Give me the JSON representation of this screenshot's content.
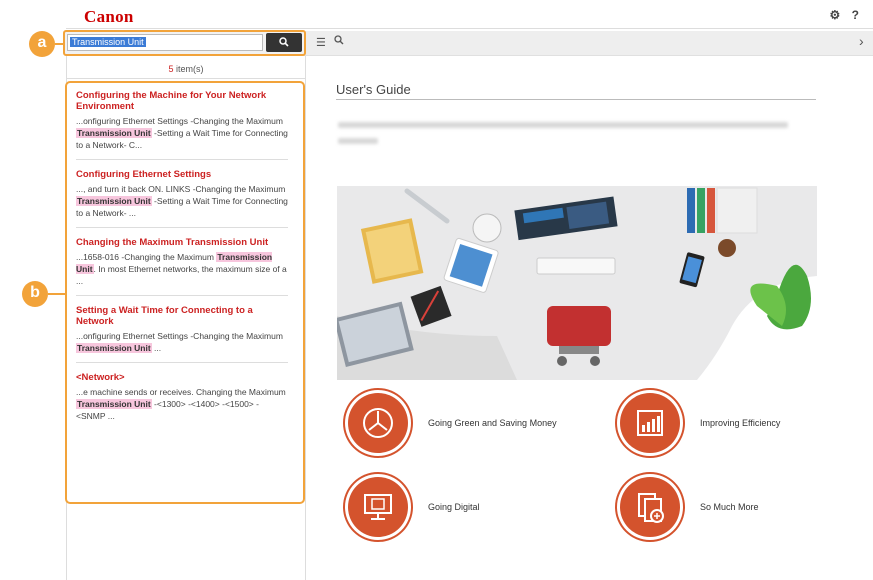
{
  "header": {
    "logo": "Canon",
    "settings_icon": "gear-icon",
    "help_icon": "help-icon",
    "help_glyph": "?"
  },
  "search": {
    "value": "Transmission Unit",
    "button_icon": "search-icon"
  },
  "toolbar": {
    "list_icon": "list-icon",
    "search_icon": "search-icon",
    "next_icon": "chevron-right-icon"
  },
  "sidebar": {
    "count": {
      "number": "5",
      "suffix": " item(s)"
    },
    "results": [
      {
        "title": "Configuring the Machine for Your Network Environment",
        "snippet_before": "...onfiguring Ethernet Settings -Changing the Maximum ",
        "highlight": "Transmission Unit",
        "snippet_after": " -Setting a Wait Time for Connecting to a Network- C..."
      },
      {
        "title": "Configuring Ethernet Settings",
        "snippet_before": "..., and turn it back ON. LINKS -Changing the Maximum ",
        "highlight": "Transmission Unit",
        "snippet_after": " -Setting a Wait Time for Connecting to a Network- ..."
      },
      {
        "title": "Changing the Maximum Transmission Unit",
        "snippet_before": "...1658-016 -Changing the Maximum ",
        "highlight": "Transmission Unit",
        "snippet_after": ". In most Ethernet networks, the maximum size of a ..."
      },
      {
        "title": "Setting a Wait Time for Connecting to a Network",
        "snippet_before": "...onfiguring Ethernet Settings -Changing the Maximum ",
        "highlight": "Transmission Unit",
        "snippet_after": " ..."
      },
      {
        "title": "<Network>",
        "snippet_before": "...e machine sends or receives. Changing the Maximum ",
        "highlight": "Transmission Unit",
        "snippet_after": " -<1300> -<1400> -<1500> -<SNMP ..."
      }
    ]
  },
  "callouts": {
    "a": "a",
    "b": "b"
  },
  "main": {
    "title": "User's Guide",
    "topics": [
      {
        "label": "Going Green and Saving Money",
        "icon": "recycle-icon"
      },
      {
        "label": "Improving Efficiency",
        "icon": "bar-chart-icon"
      },
      {
        "label": "Going Digital",
        "icon": "monitor-icon"
      },
      {
        "label": "So Much More",
        "icon": "more-documents-icon"
      }
    ]
  },
  "colors": {
    "brand_red": "#cc0000",
    "accent_orange": "#f2a33a",
    "topic_orange": "#d4532d",
    "highlight_pink": "#f7c6dd",
    "selection_blue": "#3b7bd6"
  }
}
